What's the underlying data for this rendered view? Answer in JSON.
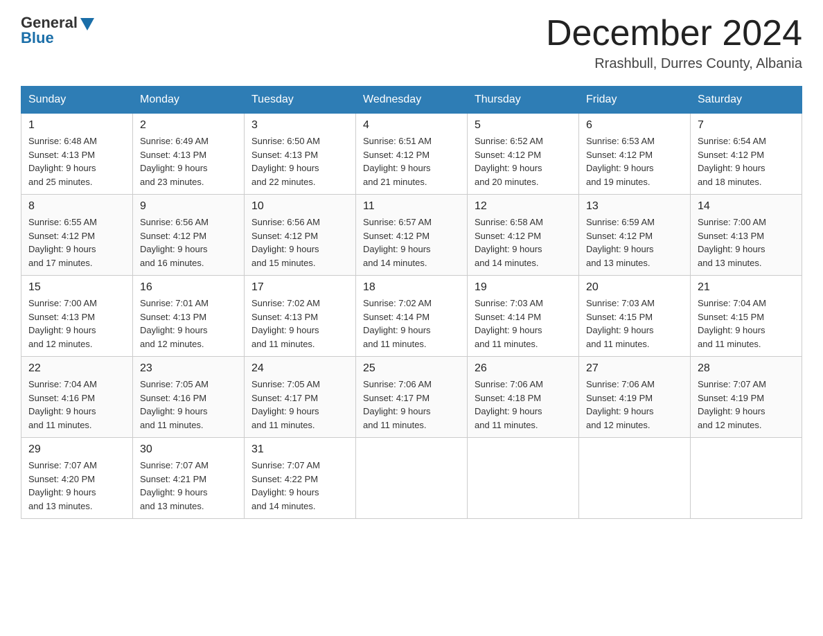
{
  "header": {
    "logo_general": "General",
    "logo_blue": "Blue",
    "month_title": "December 2024",
    "location": "Rrashbull, Durres County, Albania"
  },
  "days_of_week": [
    "Sunday",
    "Monday",
    "Tuesday",
    "Wednesday",
    "Thursday",
    "Friday",
    "Saturday"
  ],
  "weeks": [
    [
      {
        "num": "1",
        "sunrise": "6:48 AM",
        "sunset": "4:13 PM",
        "daylight": "9 hours and 25 minutes."
      },
      {
        "num": "2",
        "sunrise": "6:49 AM",
        "sunset": "4:13 PM",
        "daylight": "9 hours and 23 minutes."
      },
      {
        "num": "3",
        "sunrise": "6:50 AM",
        "sunset": "4:13 PM",
        "daylight": "9 hours and 22 minutes."
      },
      {
        "num": "4",
        "sunrise": "6:51 AM",
        "sunset": "4:12 PM",
        "daylight": "9 hours and 21 minutes."
      },
      {
        "num": "5",
        "sunrise": "6:52 AM",
        "sunset": "4:12 PM",
        "daylight": "9 hours and 20 minutes."
      },
      {
        "num": "6",
        "sunrise": "6:53 AM",
        "sunset": "4:12 PM",
        "daylight": "9 hours and 19 minutes."
      },
      {
        "num": "7",
        "sunrise": "6:54 AM",
        "sunset": "4:12 PM",
        "daylight": "9 hours and 18 minutes."
      }
    ],
    [
      {
        "num": "8",
        "sunrise": "6:55 AM",
        "sunset": "4:12 PM",
        "daylight": "9 hours and 17 minutes."
      },
      {
        "num": "9",
        "sunrise": "6:56 AM",
        "sunset": "4:12 PM",
        "daylight": "9 hours and 16 minutes."
      },
      {
        "num": "10",
        "sunrise": "6:56 AM",
        "sunset": "4:12 PM",
        "daylight": "9 hours and 15 minutes."
      },
      {
        "num": "11",
        "sunrise": "6:57 AM",
        "sunset": "4:12 PM",
        "daylight": "9 hours and 14 minutes."
      },
      {
        "num": "12",
        "sunrise": "6:58 AM",
        "sunset": "4:12 PM",
        "daylight": "9 hours and 14 minutes."
      },
      {
        "num": "13",
        "sunrise": "6:59 AM",
        "sunset": "4:12 PM",
        "daylight": "9 hours and 13 minutes."
      },
      {
        "num": "14",
        "sunrise": "7:00 AM",
        "sunset": "4:13 PM",
        "daylight": "9 hours and 13 minutes."
      }
    ],
    [
      {
        "num": "15",
        "sunrise": "7:00 AM",
        "sunset": "4:13 PM",
        "daylight": "9 hours and 12 minutes."
      },
      {
        "num": "16",
        "sunrise": "7:01 AM",
        "sunset": "4:13 PM",
        "daylight": "9 hours and 12 minutes."
      },
      {
        "num": "17",
        "sunrise": "7:02 AM",
        "sunset": "4:13 PM",
        "daylight": "9 hours and 11 minutes."
      },
      {
        "num": "18",
        "sunrise": "7:02 AM",
        "sunset": "4:14 PM",
        "daylight": "9 hours and 11 minutes."
      },
      {
        "num": "19",
        "sunrise": "7:03 AM",
        "sunset": "4:14 PM",
        "daylight": "9 hours and 11 minutes."
      },
      {
        "num": "20",
        "sunrise": "7:03 AM",
        "sunset": "4:15 PM",
        "daylight": "9 hours and 11 minutes."
      },
      {
        "num": "21",
        "sunrise": "7:04 AM",
        "sunset": "4:15 PM",
        "daylight": "9 hours and 11 minutes."
      }
    ],
    [
      {
        "num": "22",
        "sunrise": "7:04 AM",
        "sunset": "4:16 PM",
        "daylight": "9 hours and 11 minutes."
      },
      {
        "num": "23",
        "sunrise": "7:05 AM",
        "sunset": "4:16 PM",
        "daylight": "9 hours and 11 minutes."
      },
      {
        "num": "24",
        "sunrise": "7:05 AM",
        "sunset": "4:17 PM",
        "daylight": "9 hours and 11 minutes."
      },
      {
        "num": "25",
        "sunrise": "7:06 AM",
        "sunset": "4:17 PM",
        "daylight": "9 hours and 11 minutes."
      },
      {
        "num": "26",
        "sunrise": "7:06 AM",
        "sunset": "4:18 PM",
        "daylight": "9 hours and 11 minutes."
      },
      {
        "num": "27",
        "sunrise": "7:06 AM",
        "sunset": "4:19 PM",
        "daylight": "9 hours and 12 minutes."
      },
      {
        "num": "28",
        "sunrise": "7:07 AM",
        "sunset": "4:19 PM",
        "daylight": "9 hours and 12 minutes."
      }
    ],
    [
      {
        "num": "29",
        "sunrise": "7:07 AM",
        "sunset": "4:20 PM",
        "daylight": "9 hours and 13 minutes."
      },
      {
        "num": "30",
        "sunrise": "7:07 AM",
        "sunset": "4:21 PM",
        "daylight": "9 hours and 13 minutes."
      },
      {
        "num": "31",
        "sunrise": "7:07 AM",
        "sunset": "4:22 PM",
        "daylight": "9 hours and 14 minutes."
      },
      null,
      null,
      null,
      null
    ]
  ]
}
